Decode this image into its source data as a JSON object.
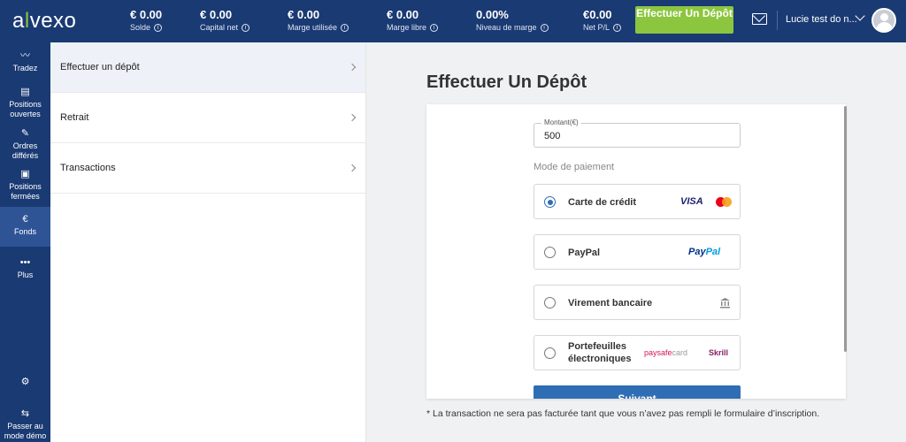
{
  "brand": {
    "logo_a": "a",
    "logo_l": "l",
    "logo_rest": "vexo"
  },
  "header": {
    "stats": [
      {
        "value": "€ 0.00",
        "label": "Solde"
      },
      {
        "value": "€ 0.00",
        "label": "Capital net"
      },
      {
        "value": "€ 0.00",
        "label": "Marge utilisée"
      },
      {
        "value": "€ 0.00",
        "label": "Marge libre"
      },
      {
        "value": "0.00%",
        "label": "Niveau de marge"
      },
      {
        "value": "€0.00",
        "label": "Net P/L"
      }
    ],
    "deposit_button": "Effectuer Un Dépôt",
    "user_name": "Lucie test do n...",
    "info_glyph": "i"
  },
  "sidebar": {
    "items": [
      {
        "label": "Tradez",
        "icon": "chart-line-icon",
        "glyph": "〰"
      },
      {
        "label": "Positions ouvertes",
        "icon": "document-icon",
        "glyph": "▤"
      },
      {
        "label": "Ordres différés",
        "icon": "edit-icon",
        "glyph": "✎"
      },
      {
        "label": "Positions fermées",
        "icon": "briefcase-icon",
        "glyph": "▣"
      },
      {
        "label": "Fonds",
        "icon": "euro-icon",
        "glyph": "€"
      },
      {
        "label": "Plus",
        "icon": "more-icon",
        "glyph": "•••"
      },
      {
        "label": "",
        "icon": "gear-icon",
        "glyph": "⚙"
      },
      {
        "label": "Passer au mode démo",
        "icon": "switch-icon",
        "glyph": "⇆"
      }
    ]
  },
  "menu": {
    "items": [
      {
        "label": "Effectuer un dépôt"
      },
      {
        "label": "Retrait"
      },
      {
        "label": "Transactions"
      }
    ]
  },
  "deposit": {
    "title": "Effectuer Un Dépôt",
    "amount_label": "Montant(€)",
    "amount_value": "500",
    "payment_heading": "Mode de paiement",
    "options": [
      {
        "label": "Carte de crédit",
        "selected": true,
        "logos": [
          "VISA",
          "mastercard"
        ]
      },
      {
        "label": "PayPal",
        "selected": false,
        "logos": [
          "PayPal"
        ]
      },
      {
        "label": "Virement bancaire",
        "selected": false,
        "logos": [
          "bank-icon"
        ]
      },
      {
        "label": "Portefeuilles électroniques",
        "label_line1": "Portefeuilles",
        "label_line2": "électroniques",
        "selected": false,
        "logos": [
          "paysafecard",
          "Skrill"
        ]
      }
    ],
    "logo_text": {
      "visa": "VISA",
      "paypal_a": "Pay",
      "paypal_b": "Pal",
      "psc_a": "paysafe",
      "psc_b": "card",
      "skrill": "Skrill"
    },
    "submit_label": "Suivant",
    "footnote": "* La transaction ne sera pas facturée tant que vous n’avez pas rempli le formulaire d’inscription."
  },
  "colors": {
    "navy": "#1a3a73",
    "green": "#8cc63f",
    "primary_blue": "#2f6db5"
  }
}
